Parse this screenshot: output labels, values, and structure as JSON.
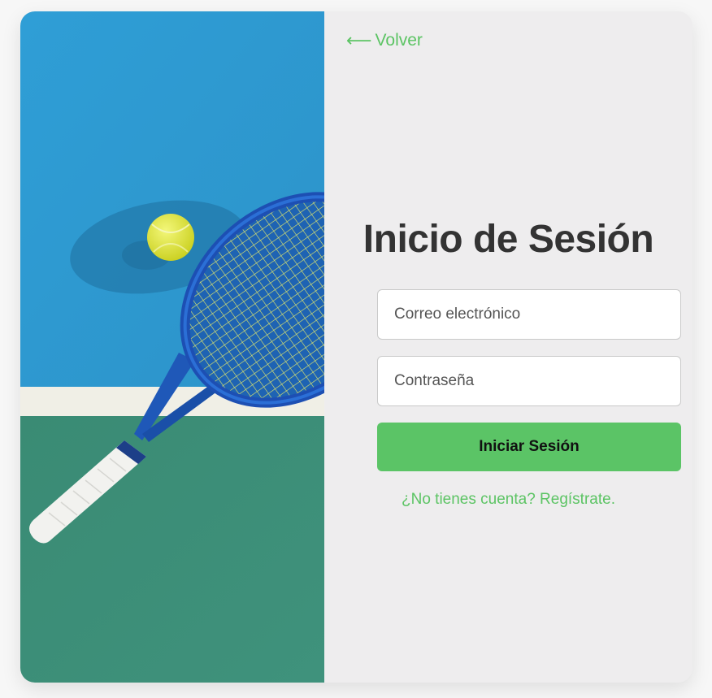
{
  "login": {
    "back_label": "Volver",
    "title": "Inicio de Sesión",
    "email_placeholder": "Correo electrónico",
    "password_placeholder": "Contraseña",
    "submit_label": "Iniciar Sesión",
    "register_label": "¿No tienes cuenta? Regístrate."
  },
  "icons": {
    "back": "arrow-left-icon"
  },
  "colors": {
    "accent": "#5bc466",
    "card_background": "#eeedee",
    "title": "#333333",
    "court_blue": "#2f9fd3",
    "court_green": "#3d8e78"
  }
}
